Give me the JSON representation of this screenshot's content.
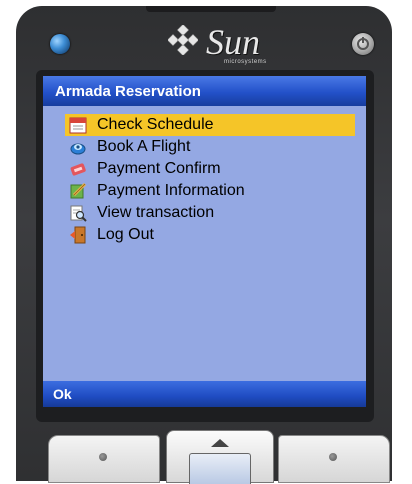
{
  "device": {
    "brand": "Sun",
    "brand_sub": "microsystems",
    "indicator_icon": "led-icon",
    "power_icon": "power-icon"
  },
  "app": {
    "title": "Armada Reservation",
    "menu": [
      {
        "label": "Check Schedule",
        "icon": "calendar-icon",
        "selected": true
      },
      {
        "label": "Book A Flight",
        "icon": "globe-icon",
        "selected": false
      },
      {
        "label": "Payment Confirm",
        "icon": "ticket-icon",
        "selected": false
      },
      {
        "label": "Payment Information",
        "icon": "edit-icon",
        "selected": false
      },
      {
        "label": "View transaction",
        "icon": "magnifier-icon",
        "selected": false
      },
      {
        "label": "Log Out",
        "icon": "door-icon",
        "selected": false
      }
    ],
    "softkey_left": "Ok"
  },
  "colors": {
    "screen_bg": "#94a8e3",
    "titlebar": "#2351c9",
    "selection": "#f5c528",
    "phone_body": "#333436"
  }
}
